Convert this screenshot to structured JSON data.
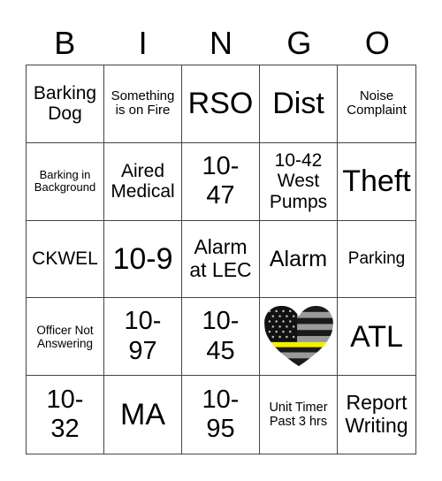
{
  "header": {
    "letters": [
      "B",
      "I",
      "N",
      "G",
      "O"
    ]
  },
  "cells": [
    {
      "text": "Barking Dog"
    },
    {
      "text": "Something is on Fire"
    },
    {
      "text": "RSO"
    },
    {
      "text": "Dist"
    },
    {
      "text": "Noise Complaint"
    },
    {
      "text": "Barking in Background"
    },
    {
      "text": "Aired Medical"
    },
    {
      "text": "10-47"
    },
    {
      "text": "10-42 West Pumps"
    },
    {
      "text": "Theft"
    },
    {
      "text": "CKWEL"
    },
    {
      "text": "10-9"
    },
    {
      "text": "Alarm at LEC"
    },
    {
      "text": "Alarm"
    },
    {
      "text": "Parking"
    },
    {
      "text": "Officer Not Answering"
    },
    {
      "text": "10-97"
    },
    {
      "text": "10-45"
    },
    {
      "text": "",
      "icon": "thin-yellow-line-flag-heart-icon"
    },
    {
      "text": "ATL"
    },
    {
      "text": "10-32"
    },
    {
      "text": "MA"
    },
    {
      "text": "10-95"
    },
    {
      "text": "Unit Timer Past 3 hrs"
    },
    {
      "text": "Report Writing"
    }
  ],
  "colors": {
    "line": "#444444",
    "flag_stripe_accent": "#f2f000"
  }
}
